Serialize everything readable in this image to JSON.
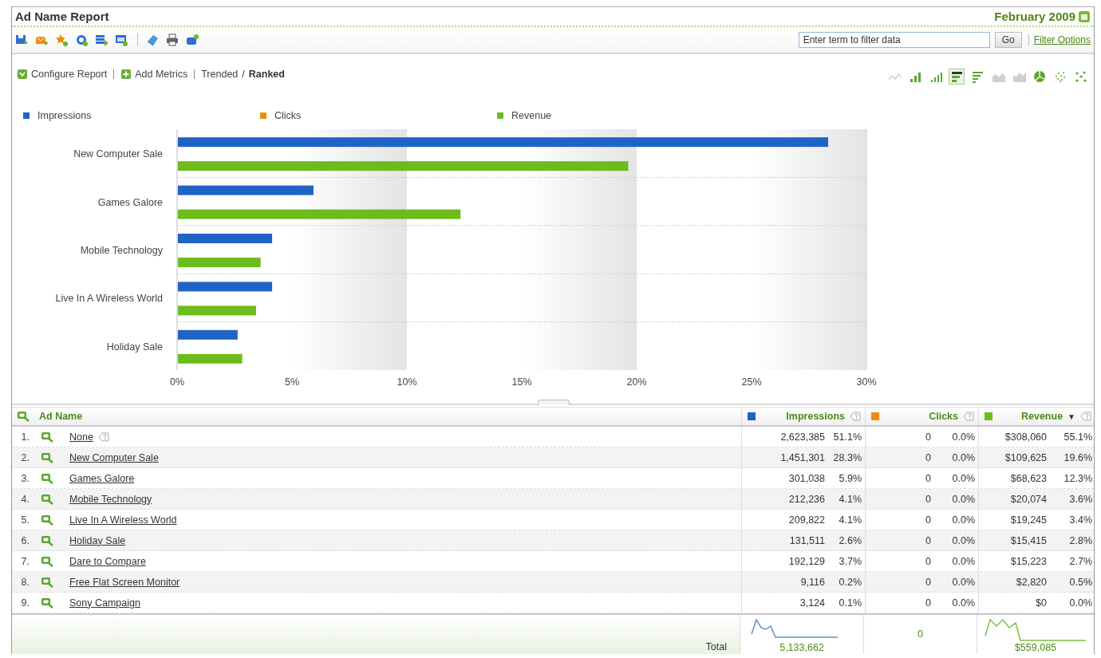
{
  "report": {
    "title": "Ad Name Report",
    "date": "February 2009"
  },
  "filter": {
    "placeholder": "Enter term to filter data",
    "button": "Go",
    "options_link": "Filter Options"
  },
  "actions": [
    {
      "label": "Configure Report",
      "kind": "configure"
    },
    {
      "label": "Add Metrics",
      "kind": "add"
    }
  ],
  "views": [
    {
      "label": "Trended",
      "selected": false
    },
    {
      "label": "Ranked",
      "selected": true
    }
  ],
  "view_separator": "/",
  "chart_types": [
    {
      "kind": "line",
      "selected": false,
      "disabled": true
    },
    {
      "kind": "bar",
      "selected": false,
      "disabled": false
    },
    {
      "kind": "bar-stacked",
      "selected": false,
      "disabled": false
    },
    {
      "kind": "hbar",
      "selected": true,
      "disabled": false
    },
    {
      "kind": "hbar-stacked",
      "selected": false,
      "disabled": false
    },
    {
      "kind": "area",
      "selected": false,
      "disabled": true
    },
    {
      "kind": "area-stacked",
      "selected": false,
      "disabled": true
    },
    {
      "kind": "pie",
      "selected": false,
      "disabled": false
    },
    {
      "kind": "scatter-dense",
      "selected": false,
      "disabled": false
    },
    {
      "kind": "scatter",
      "selected": false,
      "disabled": false
    }
  ],
  "chart": {
    "chart_data": {
      "type": "bar",
      "orientation": "horizontal",
      "categories": [
        "New Computer Sale",
        "Games Galore",
        "Mobile Technology",
        "Live In A Wireless World",
        "Holiday Sale"
      ],
      "series": [
        {
          "name": "Impressions",
          "color": "#1f63c6",
          "values": [
            28.3,
            5.9,
            4.1,
            4.1,
            2.6
          ]
        },
        {
          "name": "Clicks",
          "color": "#f08c0c",
          "values": [
            0,
            0,
            0,
            0,
            0
          ]
        },
        {
          "name": "Revenue",
          "color": "#6cbc1c",
          "values": [
            19.6,
            12.3,
            3.6,
            3.4,
            2.8
          ]
        }
      ],
      "xlim": [
        0,
        30
      ],
      "xticks": [
        {
          "value": 0,
          "label": "0%"
        },
        {
          "value": 5,
          "label": "5%"
        },
        {
          "value": 10,
          "label": "10%"
        },
        {
          "value": 15,
          "label": "15%"
        },
        {
          "value": 20,
          "label": "20%"
        },
        {
          "value": 25,
          "label": "25%"
        },
        {
          "value": 30,
          "label": "30%"
        }
      ]
    }
  },
  "table": {
    "columns": [
      {
        "label": "Ad Name"
      },
      {
        "label": "Impressions",
        "color": "#1f63c6"
      },
      {
        "label": "Clicks",
        "color": "#f08c0c"
      },
      {
        "label": "Revenue",
        "color": "#6cbc1c",
        "sort_mark": "▼"
      }
    ],
    "rows": [
      {
        "rank": "1.",
        "name": "None",
        "help": true,
        "impressions": {
          "value": "2,623,385",
          "share": "51.1%"
        },
        "clicks": {
          "value": "0",
          "share": "0.0%"
        },
        "revenue": {
          "value": "$308,060",
          "share": "55.1%"
        }
      },
      {
        "rank": "2.",
        "name": "New Computer Sale",
        "help": false,
        "impressions": {
          "value": "1,451,301",
          "share": "28.3%"
        },
        "clicks": {
          "value": "0",
          "share": "0.0%"
        },
        "revenue": {
          "value": "$109,625",
          "share": "19.6%"
        }
      },
      {
        "rank": "3.",
        "name": "Games Galore",
        "help": false,
        "impressions": {
          "value": "301,038",
          "share": "5.9%"
        },
        "clicks": {
          "value": "0",
          "share": "0.0%"
        },
        "revenue": {
          "value": "$68,623",
          "share": "12.3%"
        }
      },
      {
        "rank": "4.",
        "name": "Mobile Technology",
        "help": false,
        "impressions": {
          "value": "212,236",
          "share": "4.1%"
        },
        "clicks": {
          "value": "0",
          "share": "0.0%"
        },
        "revenue": {
          "value": "$20,074",
          "share": "3.6%"
        }
      },
      {
        "rank": "5.",
        "name": "Live In A Wireless World",
        "help": false,
        "impressions": {
          "value": "209,822",
          "share": "4.1%"
        },
        "clicks": {
          "value": "0",
          "share": "0.0%"
        },
        "revenue": {
          "value": "$19,245",
          "share": "3.4%"
        }
      },
      {
        "rank": "6.",
        "name": "Holiday Sale",
        "help": false,
        "impressions": {
          "value": "131,511",
          "share": "2.6%"
        },
        "clicks": {
          "value": "0",
          "share": "0.0%"
        },
        "revenue": {
          "value": "$15,415",
          "share": "2.8%"
        }
      },
      {
        "rank": "7.",
        "name": "Dare to Compare",
        "help": false,
        "impressions": {
          "value": "192,129",
          "share": "3.7%"
        },
        "clicks": {
          "value": "0",
          "share": "0.0%"
        },
        "revenue": {
          "value": "$15,223",
          "share": "2.7%"
        }
      },
      {
        "rank": "8.",
        "name": "Free Flat Screen Monitor",
        "help": false,
        "impressions": {
          "value": "9,116",
          "share": "0.2%"
        },
        "clicks": {
          "value": "0",
          "share": "0.0%"
        },
        "revenue": {
          "value": "$2,820",
          "share": "0.5%"
        }
      },
      {
        "rank": "9.",
        "name": "Sony Campaign",
        "help": false,
        "impressions": {
          "value": "3,124",
          "share": "0.1%"
        },
        "clicks": {
          "value": "0",
          "share": "0.0%"
        },
        "revenue": {
          "value": "$0",
          "share": "0.0%"
        }
      }
    ],
    "total": {
      "label": "Total",
      "values": [
        "5,133,662",
        "0",
        "$559,085"
      ]
    }
  }
}
